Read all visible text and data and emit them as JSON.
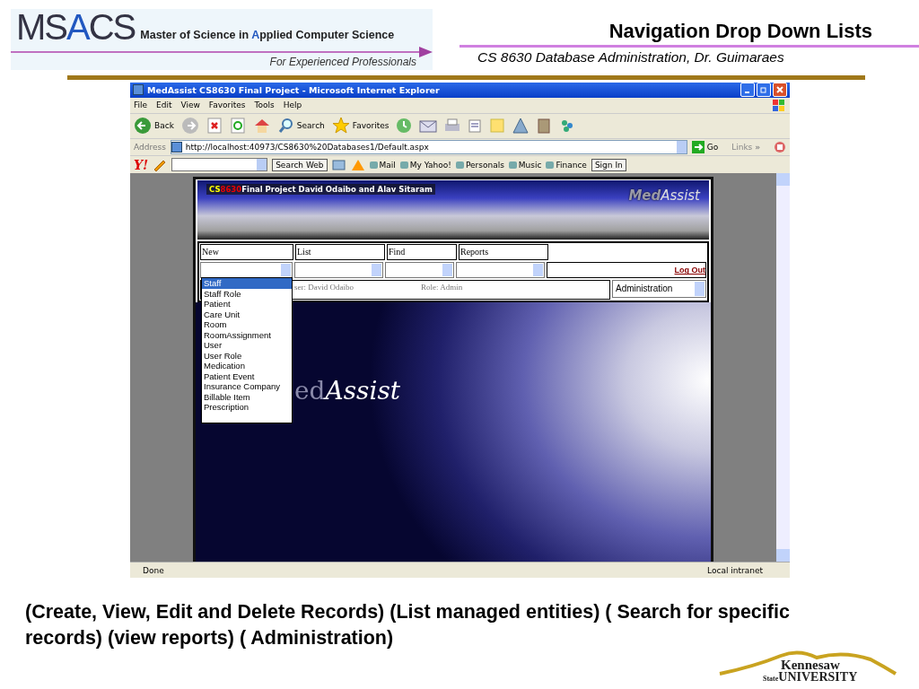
{
  "slide": {
    "logo_parts": [
      "MS",
      "A",
      "CS"
    ],
    "logo_subtitle_parts": [
      "Master of Science in ",
      "A",
      "pplied Computer Science"
    ],
    "tagline": "For Experienced Professionals",
    "title": "Navigation Drop Down Lists",
    "subtitle": "CS 8630 Database Administration, Dr. Guimaraes"
  },
  "browser": {
    "title": "MedAssist CS8630 Final Project - Microsoft Internet Explorer",
    "menu": [
      "File",
      "Edit",
      "View",
      "Favorites",
      "Tools",
      "Help"
    ],
    "back": "Back",
    "search": "Search",
    "favorites": "Favorites",
    "address_label": "Address",
    "address": "http://localhost:40973/CS8630%20Databases1/Default.aspx",
    "go": "Go",
    "links": "Links",
    "links_chevron": "»",
    "yahoo_logo": "Y!",
    "yahoo_search": "Search Web",
    "yahoo_items": [
      "Mail",
      "My Yahoo!",
      "Personals",
      "Music",
      "Finance"
    ],
    "sign_in": "Sign In",
    "status": "Done",
    "zone": "Local intranet"
  },
  "page": {
    "banner_parts": [
      "CS",
      "8630",
      "Final Project  David Odaibo and Alav Sitaram"
    ],
    "brand_parts": [
      "Med",
      "Assist"
    ],
    "nav": [
      {
        "label": "New",
        "open": true
      },
      {
        "label": "List",
        "open": false
      },
      {
        "label": "Find",
        "open": false
      },
      {
        "label": "Reports",
        "open": false
      }
    ],
    "logout": "Log Out",
    "user": "ser: David Odaibo",
    "role": "Role: Admin",
    "admin_select": "Administration",
    "dropdown": [
      {
        "label": "Staff",
        "selected": true
      },
      {
        "label": "Staff Role",
        "selected": false
      },
      {
        "label": "Patient",
        "selected": false
      },
      {
        "label": "Care Unit",
        "selected": false
      },
      {
        "label": "Room",
        "selected": false
      },
      {
        "label": "RoomAssignment",
        "selected": false
      },
      {
        "label": "User",
        "selected": false
      },
      {
        "label": "User Role",
        "selected": false
      },
      {
        "label": "Medication",
        "selected": false
      },
      {
        "label": "Patient Event",
        "selected": false
      },
      {
        "label": "Insurance Company",
        "selected": false
      },
      {
        "label": "Billable Item",
        "selected": false
      },
      {
        "label": "Prescription",
        "selected": false
      }
    ],
    "hero_parts": [
      "ed",
      "Assist"
    ]
  },
  "caption": "(Create, View, Edit and Delete Records) (List managed entities) ( Search for specific records) (view reports) ( Administration)",
  "university_parts": [
    "Kennesaw",
    "State",
    "UNIVERSITY"
  ]
}
